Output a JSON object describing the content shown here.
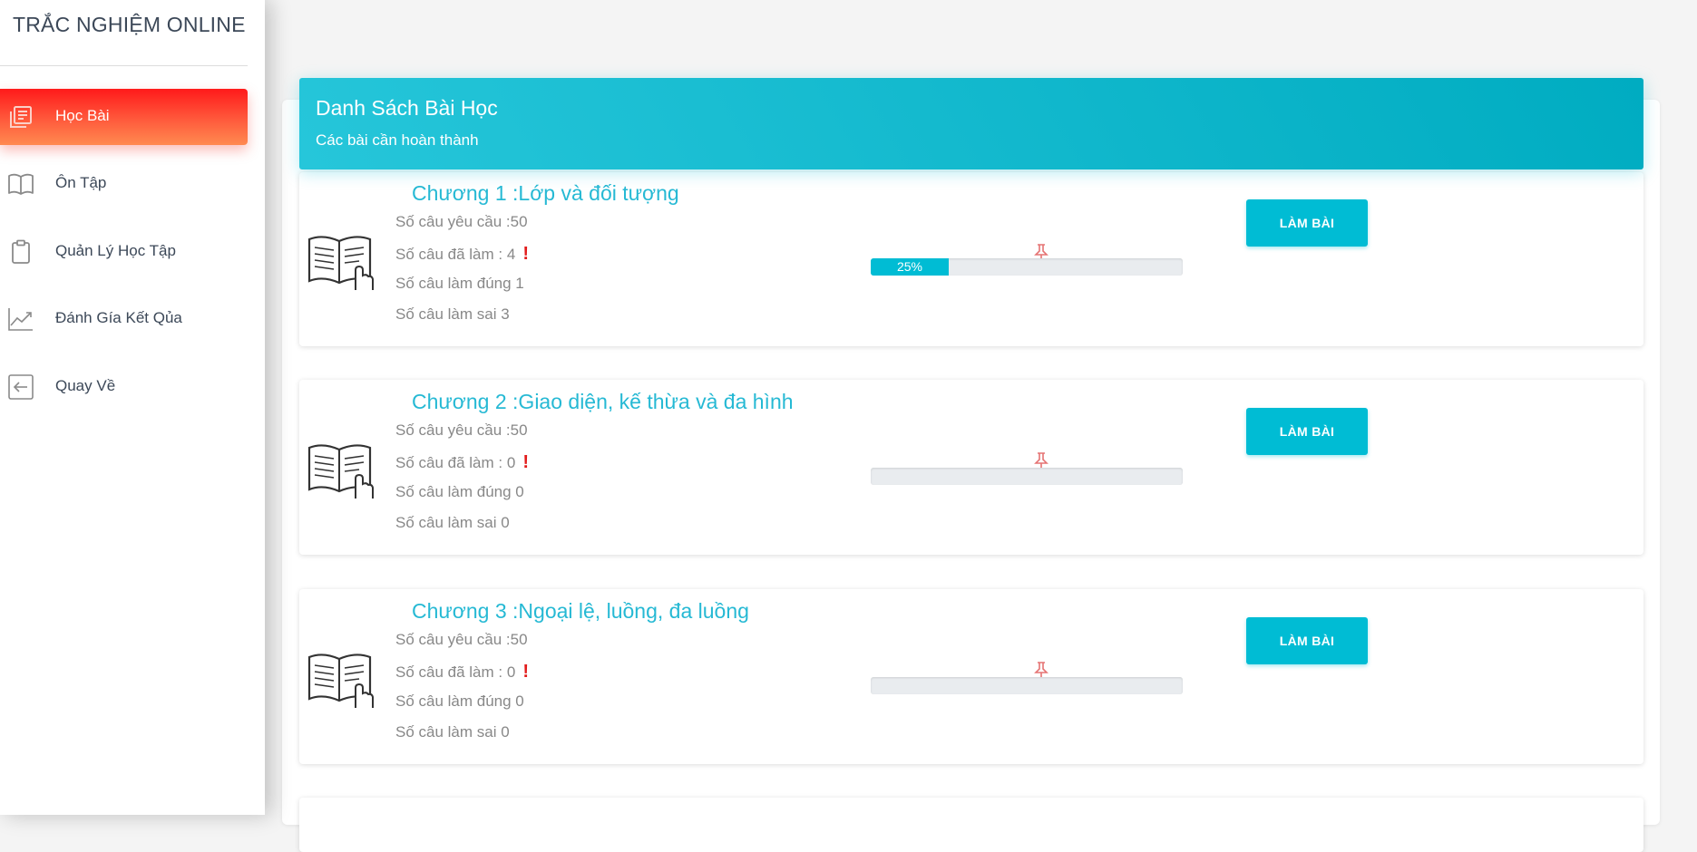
{
  "app": {
    "brand": "TRẮC NGHIỆM ONLINE"
  },
  "sidebar": {
    "items": [
      {
        "label": "Học Bài",
        "icon": "library-books-icon",
        "active": true
      },
      {
        "label": "Ôn Tập",
        "icon": "book-open-icon",
        "active": false
      },
      {
        "label": "Quản Lý Học Tập",
        "icon": "clipboard-icon",
        "active": false
      },
      {
        "label": "Đánh Gía Kết Qủa",
        "icon": "trending-up-icon",
        "active": false
      },
      {
        "label": "Quay Về",
        "icon": "arrow-left-box-icon",
        "active": false
      }
    ]
  },
  "header": {
    "title": "Danh Sách Bài Học",
    "subtitle": "Các bài cần hoàn thành"
  },
  "lessons": [
    {
      "title": "Chương 1 :Lớp và đối tượng",
      "required": "Số câu yêu cầu :50",
      "done": "Số câu đã làm : 4",
      "correct": "Số câu làm đúng 1",
      "wrong": "Số câu làm sai 3",
      "progress_percent": 25,
      "progress_label": "25%",
      "button": "LÀM BÀI"
    },
    {
      "title": "Chương 2 :Giao diện, kế thừa và đa hình",
      "required": "Số câu yêu cầu :50",
      "done": "Số câu đã làm : 0",
      "correct": "Số câu làm đúng 0",
      "wrong": "Số câu làm sai 0",
      "progress_percent": 0,
      "progress_label": "",
      "button": "LÀM BÀI"
    },
    {
      "title": "Chương 3 :Ngoại lệ, luồng, đa luồng",
      "required": "Số câu yêu cầu :50",
      "done": "Số câu đã làm : 0",
      "correct": "Số câu làm đúng 0",
      "wrong": "Số câu làm sai 0",
      "progress_percent": 0,
      "progress_label": "",
      "button": "LÀM BÀI"
    }
  ],
  "colors": {
    "accent": "#00bcd4",
    "title_text": "#26b9d4",
    "active_nav": "#ff3d2e",
    "alert": "#e21b1b"
  }
}
